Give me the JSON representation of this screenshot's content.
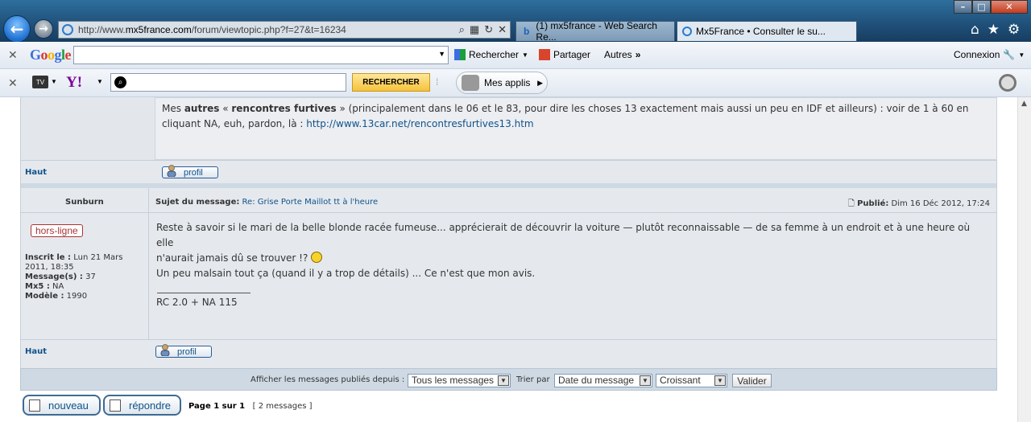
{
  "browser": {
    "address": {
      "prefix": "http://www.",
      "domain": "mx5france.com",
      "path": "/forum/viewtopic.php?f=27&t=16234"
    },
    "tabs": [
      {
        "label": "(1) mx5france - Web Search Re..."
      },
      {
        "label": "Mx5France • Consulter le su..."
      }
    ]
  },
  "google_toolbar": {
    "logo": "Google",
    "search_label": "Rechercher",
    "share_label": "Partager",
    "more_label": "Autres",
    "connect_label": "Connexion"
  },
  "yahoo_toolbar": {
    "logo": "Y!",
    "search_button": "RECHERCHER",
    "apps_label": "Mes applis"
  },
  "forum": {
    "prev_post": {
      "sig_before": "Mes ",
      "sig_bold1": "autres",
      "sig_mid1": " « ",
      "sig_bold2": "rencontres furtives",
      "sig_mid2": " » (principalement dans le 06 et le 83, pour dire les choses 13 exactement mais aussi un peu en IDF et ailleurs) : voir de 1 à 60 en cliquant NA, euh, pardon, là : ",
      "sig_link": "http://www.13car.net/rencontresfurtives13.htm",
      "top_link": "Haut",
      "profile_btn": "profil"
    },
    "post": {
      "author": "Sunburn",
      "subject_label": "Sujet du message:",
      "subject": "Re: Grise Porte Maillot tt à l'heure",
      "published_label": "Publié:",
      "published_date": "Dim 16 Déc 2012, 17:24",
      "status": "hors-ligne",
      "joined_label": "Inscrit le :",
      "joined_value": "Lun 21 Mars 2011, 18:35",
      "messages_label": "Message(s) :",
      "messages_value": "37",
      "mx5_label": "Mx5 :",
      "mx5_value": "NA",
      "model_label": "Modèle :",
      "model_value": "1990",
      "body_line1": "Reste à savoir si le mari de la belle blonde racée fumeuse... apprécierait de découvrir la voiture — plutôt reconnaissable — de sa femme à un endroit et à une heure où elle",
      "body_line2": "n'aurait jamais dû se trouver !? ",
      "body_line3": "Un peu malsain tout ça (quand il y a trop de détails) ... Ce n'est que mon avis.",
      "signature": "RC 2.0 + NA 115",
      "top_link": "Haut",
      "profile_btn": "profil"
    },
    "sortbar": {
      "display_label": "Afficher les messages publiés depuis :",
      "display_value": "Tous les messages",
      "sort_label": "Trier par",
      "sort_value": "Date du message",
      "order_value": "Croissant",
      "submit": "Valider"
    },
    "buttons": {
      "new": "nouveau",
      "reply": "répondre"
    },
    "pagination": {
      "page": "Page 1 sur 1",
      "count": "[ 2 messages ]"
    }
  }
}
